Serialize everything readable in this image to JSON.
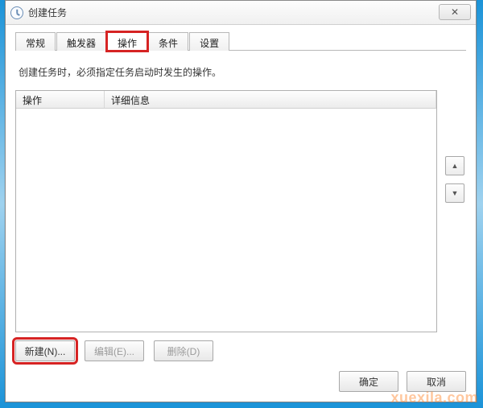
{
  "window": {
    "title": "创建任务",
    "close_glyph": "✕"
  },
  "tabs": [
    {
      "label": "常规",
      "active": false
    },
    {
      "label": "触发器",
      "active": false
    },
    {
      "label": "操作",
      "active": true,
      "highlight": true
    },
    {
      "label": "条件",
      "active": false
    },
    {
      "label": "设置",
      "active": false
    }
  ],
  "helptext": "创建任务时，必须指定任务启动时发生的操作。",
  "list": {
    "columns": [
      "操作",
      "详细信息"
    ],
    "rows": []
  },
  "side": {
    "up_glyph": "▲",
    "down_glyph": "▼"
  },
  "actions": {
    "new_label": "新建(N)...",
    "edit_label": "编辑(E)...",
    "delete_label": "删除(D)"
  },
  "footer": {
    "ok_label": "确定",
    "cancel_label": "取消"
  },
  "watermark": "xuexila.com"
}
